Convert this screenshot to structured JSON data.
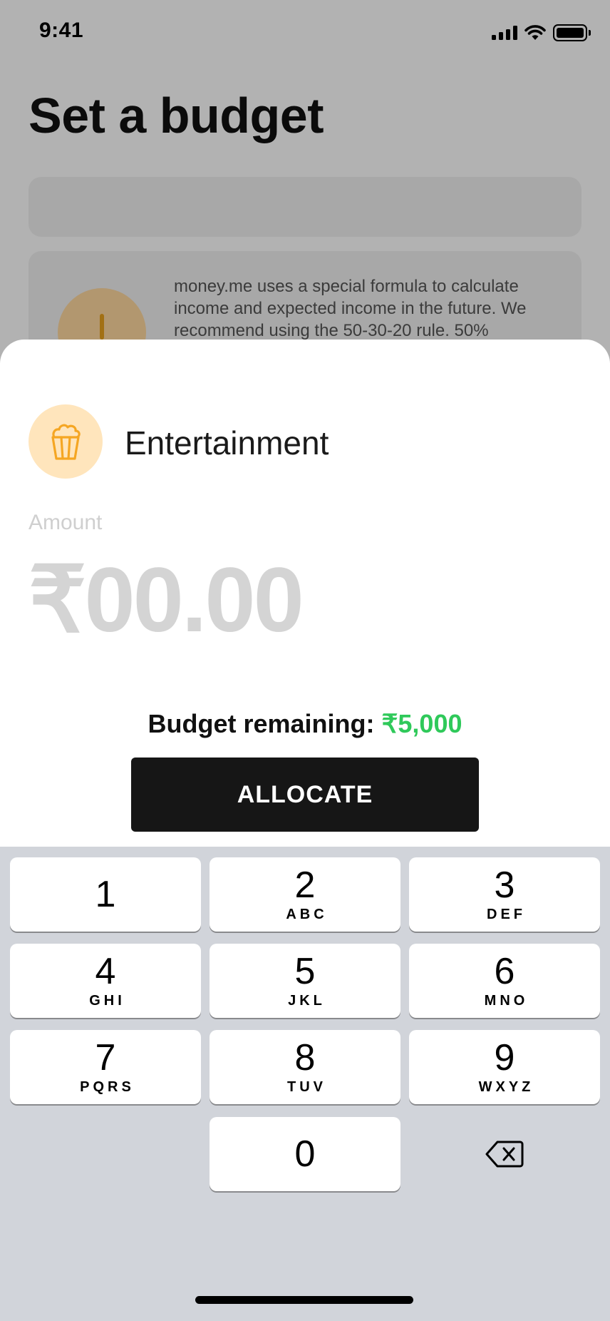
{
  "status_bar": {
    "time": "9:41"
  },
  "background": {
    "title": "Set a budget",
    "info_text": "money.me uses a special formula to calculate income and expected income in the future. We recommend using the 50-30-20 rule. 50%"
  },
  "sheet": {
    "category_name": "Entertainment",
    "category_icon": "popcorn-icon",
    "amount_label": "Amount",
    "amount_value": "₹00.00",
    "budget_label": "Budget remaining: ",
    "budget_value": "₹5,000",
    "allocate_label": "ALLOCATE"
  },
  "keypad": {
    "keys": [
      {
        "digit": "1",
        "letters": ""
      },
      {
        "digit": "2",
        "letters": "ABC"
      },
      {
        "digit": "3",
        "letters": "DEF"
      },
      {
        "digit": "4",
        "letters": "GHI"
      },
      {
        "digit": "5",
        "letters": "JKL"
      },
      {
        "digit": "6",
        "letters": "MNO"
      },
      {
        "digit": "7",
        "letters": "PQRS"
      },
      {
        "digit": "8",
        "letters": "TUV"
      },
      {
        "digit": "9",
        "letters": "WXYZ"
      },
      {
        "digit": "0",
        "letters": ""
      }
    ]
  },
  "colors": {
    "accent_green": "#2fc95a",
    "button_dark": "#161616",
    "category_icon_bg": "#ffe5bc",
    "category_icon_stroke": "#f5a623",
    "keypad_bg": "#d1d4da"
  }
}
